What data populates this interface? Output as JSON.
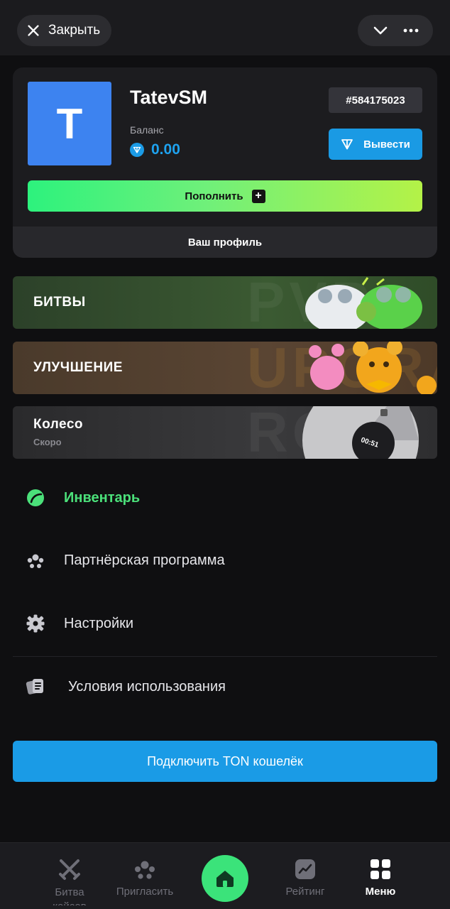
{
  "topbar": {
    "close_label": "Закрыть"
  },
  "profile": {
    "avatar_letter": "T",
    "username": "TatevSM",
    "balance_label": "Баланс",
    "balance_value": "0.00",
    "user_id": "#584175023",
    "withdraw_label": "Вывести",
    "topup_label": "Пополнить",
    "profile_link": "Ваш профиль"
  },
  "banners": [
    {
      "title": "БИТВЫ",
      "ghost": "PVP"
    },
    {
      "title": "УЛУЧШЕНИЕ",
      "ghost": "UPGRADE"
    },
    {
      "title": "Колесо",
      "subtitle": "Скоро",
      "ghost": "ROLL",
      "timer": "00:51"
    }
  ],
  "menu": [
    {
      "label": "Инвентарь",
      "icon": "inventory-icon"
    },
    {
      "label": "Партнёрская программа",
      "icon": "partners-icon"
    },
    {
      "label": "Настройки",
      "icon": "gear-icon"
    },
    {
      "label": "Условия использования",
      "icon": "terms-icon"
    }
  ],
  "connect_label": "Подключить TON кошелёк",
  "nav": [
    {
      "label": "Битва кейсов",
      "icon": "swords-icon"
    },
    {
      "label": "Пригласить",
      "icon": "invite-icon"
    },
    {
      "label": "",
      "icon": "home-icon"
    },
    {
      "label": "Рейтинг",
      "icon": "rating-icon"
    },
    {
      "label": "Меню",
      "icon": "menu-grid-icon"
    }
  ],
  "colors": {
    "accent_blue": "#1a9be6",
    "accent_green": "#3be37a",
    "background": "#0f0f11"
  }
}
